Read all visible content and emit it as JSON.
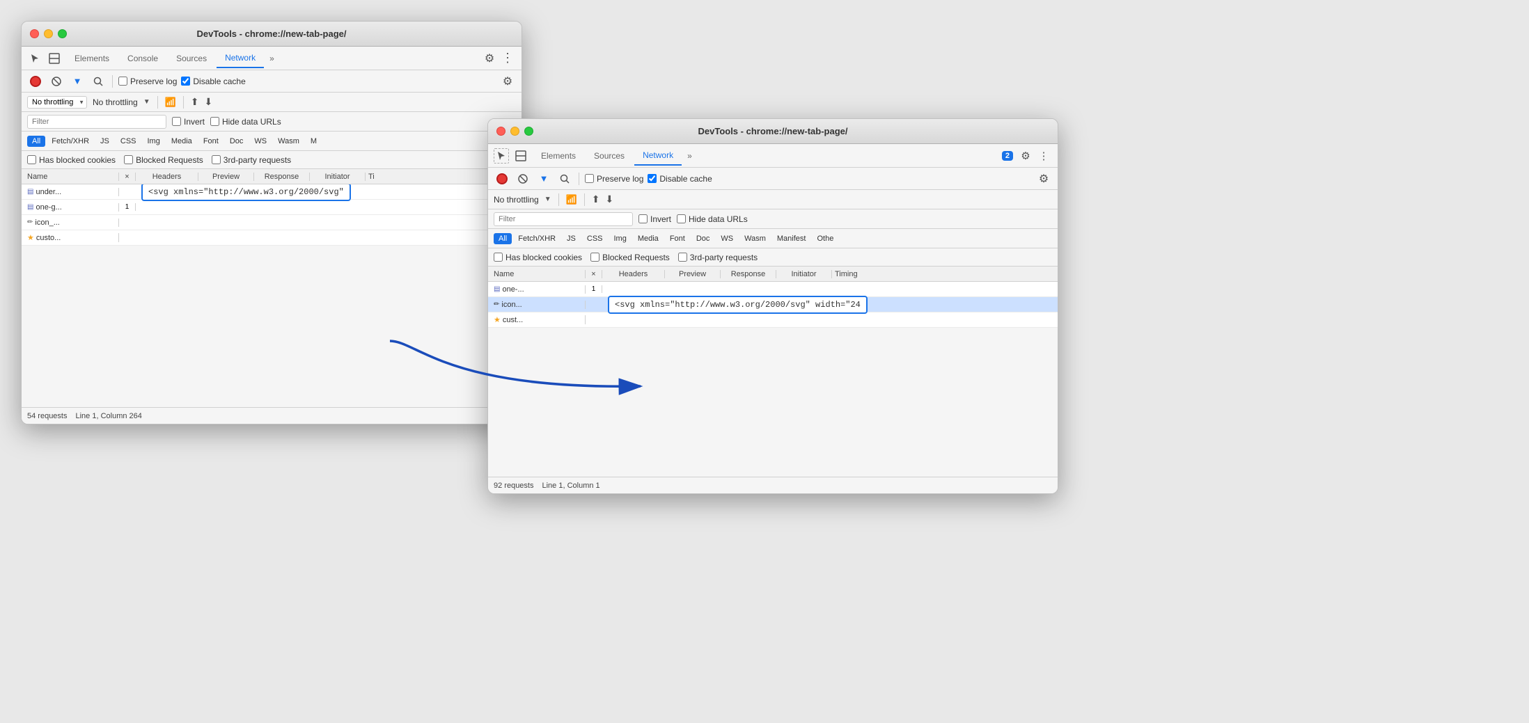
{
  "window_back": {
    "title": "DevTools - chrome://new-tab-page/",
    "tabs": [
      "Elements",
      "Console",
      "Sources",
      "Network",
      "»"
    ],
    "active_tab": "Network",
    "toolbar": {
      "preserve_log": "Preserve log",
      "disable_cache": "Disable cache"
    },
    "throttling": "No throttling",
    "filter_placeholder": "Filter",
    "filter_options": [
      "Invert",
      "Hide data URLs"
    ],
    "type_filters": [
      "All",
      "Fetch/XHR",
      "JS",
      "CSS",
      "Img",
      "Media",
      "Font",
      "Doc",
      "WS",
      "Wasm",
      "M"
    ],
    "active_type": "All",
    "checkboxes": [
      "Has blocked cookies",
      "Blocked Requests",
      "3rd-party requests"
    ],
    "table_headers": [
      "Name",
      "×",
      "Headers",
      "Preview",
      "Response",
      "Initiator",
      "Ti"
    ],
    "rows": [
      {
        "icon": "doc",
        "name": "under...",
        "number": null
      },
      {
        "icon": "doc",
        "name": "one-g...",
        "number": "1"
      },
      {
        "icon": "pencil",
        "name": "icon_...",
        "number": null
      },
      {
        "icon": "star",
        "name": "custo...",
        "number": null
      }
    ],
    "response_preview": "<svg xmlns=\"http://www.w3.org/2000/svg\"",
    "status": "54 requests",
    "status_detail": "Line 1, Column 264"
  },
  "window_front": {
    "title": "DevTools - chrome://new-tab-page/",
    "tabs": [
      "Elements",
      "Sources",
      "Network",
      "»"
    ],
    "active_tab": "Network",
    "badge_count": "2",
    "toolbar": {
      "preserve_log": "Preserve log",
      "disable_cache": "Disable cache"
    },
    "throttling": "No throttling",
    "filter_placeholder": "Filter",
    "filter_options": [
      "Invert",
      "Hide data URLs"
    ],
    "type_filters": [
      "All",
      "Fetch/XHR",
      "JS",
      "CSS",
      "Img",
      "Media",
      "Font",
      "Doc",
      "WS",
      "Wasm",
      "Manifest",
      "Othe"
    ],
    "active_type": "All",
    "checkboxes": [
      "Has blocked cookies",
      "Blocked Requests",
      "3rd-party requests"
    ],
    "table_headers": [
      "Name",
      "×",
      "Headers",
      "Preview",
      "Response",
      "Initiator",
      "Timing"
    ],
    "rows": [
      {
        "icon": "doc",
        "name": "one-...",
        "number": "1"
      },
      {
        "icon": "pencil",
        "name": "icon...",
        "number": null,
        "selected": true
      },
      {
        "icon": "star",
        "name": "cust...",
        "number": null
      }
    ],
    "response_preview": "<svg xmlns=\"http://www.w3.org/2000/svg\" width=\"24",
    "status": "92 requests",
    "status_detail": "Line 1, Column 1"
  }
}
